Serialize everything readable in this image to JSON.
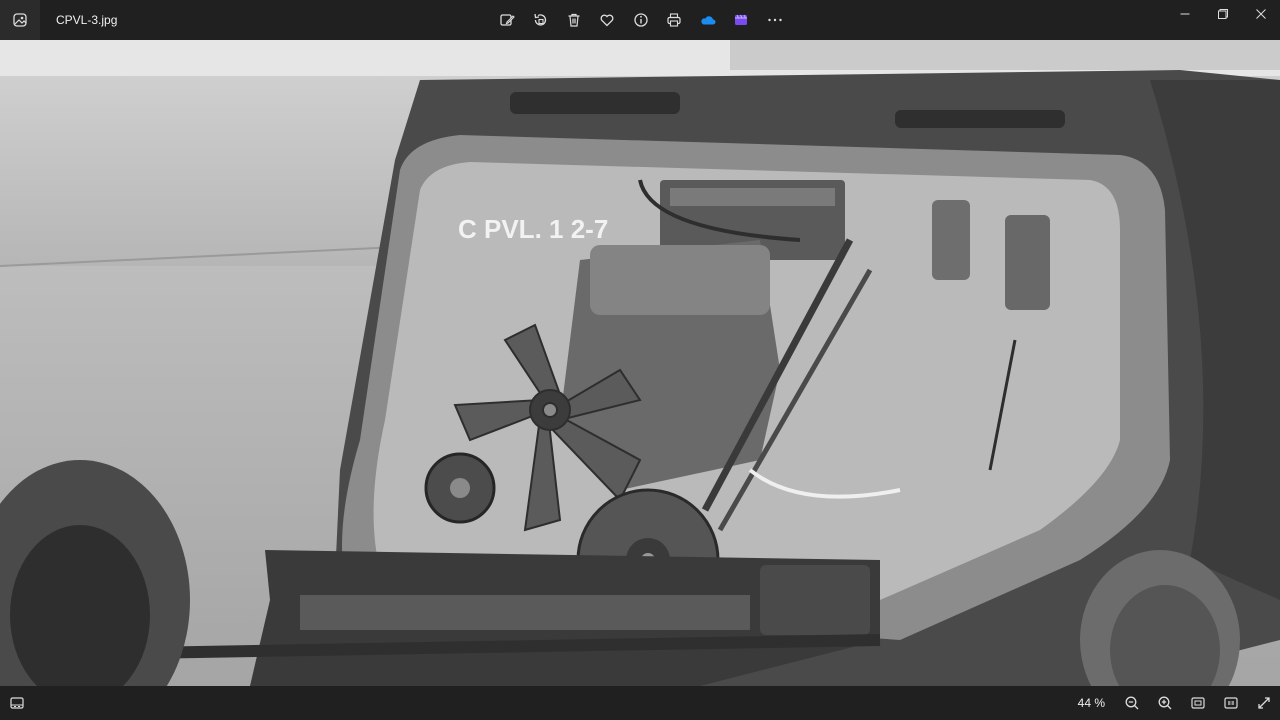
{
  "window": {
    "filename": "CPVL-3.jpg"
  },
  "toolbar": {
    "buttons": [
      {
        "name": "edit-image-icon"
      },
      {
        "name": "rotate-icon"
      },
      {
        "name": "delete-icon"
      },
      {
        "name": "favorite-heart-icon"
      },
      {
        "name": "file-info-icon"
      },
      {
        "name": "print-icon"
      },
      {
        "name": "onedrive-cloud-icon",
        "color": "#1b8cf0"
      },
      {
        "name": "clipchamp-icon",
        "color": "#7a4cf0"
      },
      {
        "name": "more-options-icon"
      }
    ]
  },
  "photo": {
    "painted_text": "C PVL. 1 2-7"
  },
  "status": {
    "zoom_level": "44 %"
  }
}
